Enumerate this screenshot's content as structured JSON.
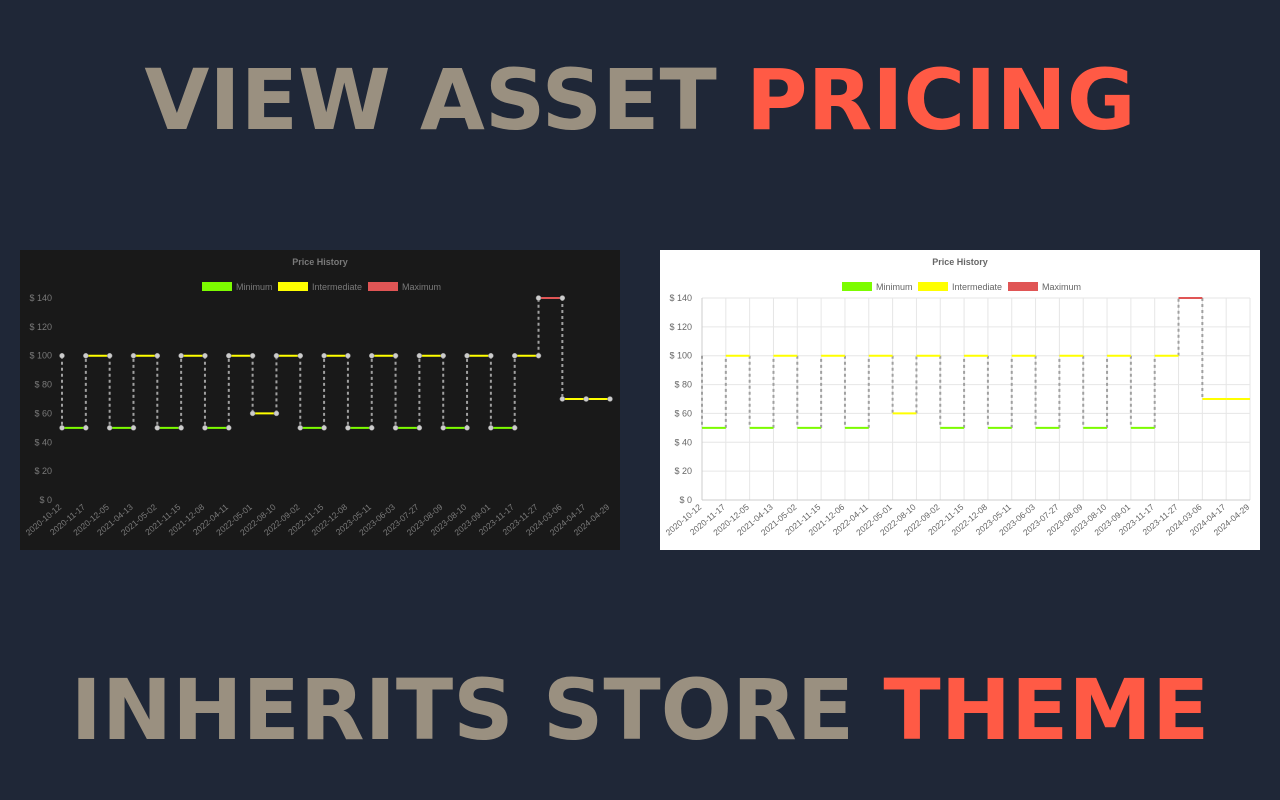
{
  "headline_top": {
    "part1": "VIEW ASSET ",
    "part2": "PRICING"
  },
  "headline_bottom": {
    "part1": "INHERITS STORE ",
    "part2": "THEME"
  },
  "colors": {
    "background": "#1f2737",
    "muted_text": "#9a9080",
    "accent_text": "#ff5a45",
    "minimum": "#7cfc00",
    "intermediate": "#ffff00",
    "maximum": "#e05555",
    "connector": "#a0a0a0"
  },
  "chart_data": [
    {
      "theme": "dark",
      "type": "line",
      "title": "Price History",
      "legend": [
        "Minimum",
        "Intermediate",
        "Maximum"
      ],
      "legend_position": "top",
      "grid": false,
      "y_tick_labels": [
        "$ 0",
        "$ 20",
        "$ 40",
        "$ 60",
        "$ 80",
        "$ 100",
        "$ 120",
        "$ 140"
      ],
      "ylim": [
        0,
        140
      ],
      "x": [
        "2020-10-12",
        "2020-11-17",
        "2020-12-05",
        "2021-04-13",
        "2021-05-02",
        "2021-11-15",
        "2021-12-08",
        "2022-04-11",
        "2022-05-01",
        "2022-08-10",
        "2022-09-02",
        "2022-11-15",
        "2022-12-08",
        "2023-05-11",
        "2023-06-03",
        "2023-07-27",
        "2023-08-09",
        "2023-08-10",
        "2023-09-01",
        "2023-11-17",
        "2023-11-27",
        "2024-03-06",
        "2024-04-17",
        "2024-04-29"
      ],
      "values": [
        50,
        100,
        50,
        100,
        50,
        100,
        50,
        100,
        60,
        100,
        50,
        100,
        50,
        100,
        50,
        100,
        50,
        100,
        50,
        100,
        140,
        70,
        70
      ],
      "levels": [
        "Minimum",
        "Intermediate",
        "Minimum",
        "Intermediate",
        "Minimum",
        "Intermediate",
        "Minimum",
        "Intermediate",
        "Intermediate",
        "Intermediate",
        "Minimum",
        "Intermediate",
        "Minimum",
        "Intermediate",
        "Minimum",
        "Intermediate",
        "Minimum",
        "Intermediate",
        "Minimum",
        "Intermediate",
        "Maximum",
        "Intermediate",
        "Intermediate"
      ]
    },
    {
      "theme": "light",
      "type": "line",
      "title": "Price History",
      "legend": [
        "Minimum",
        "Intermediate",
        "Maximum"
      ],
      "legend_position": "top",
      "grid": true,
      "y_tick_labels": [
        "$ 0",
        "$ 20",
        "$ 40",
        "$ 60",
        "$ 80",
        "$ 100",
        "$ 120",
        "$ 140"
      ],
      "ylim": [
        0,
        140
      ],
      "x": [
        "2020-10-12",
        "2020-11-17",
        "2020-12-05",
        "2021-04-13",
        "2021-05-02",
        "2021-11-15",
        "2021-12-06",
        "2022-04-11",
        "2022-05-01",
        "2022-08-10",
        "2022-09-02",
        "2022-11-15",
        "2022-12-08",
        "2023-05-11",
        "2023-06-03",
        "2023-07-27",
        "2023-08-09",
        "2023-08-10",
        "2023-09-01",
        "2023-11-17",
        "2023-11-27",
        "2024-03-06",
        "2024-04-17",
        "2024-04-29"
      ],
      "values": [
        50,
        100,
        50,
        100,
        50,
        100,
        50,
        100,
        60,
        100,
        50,
        100,
        50,
        100,
        50,
        100,
        50,
        100,
        50,
        100,
        140,
        70,
        70
      ],
      "levels": [
        "Minimum",
        "Intermediate",
        "Minimum",
        "Intermediate",
        "Minimum",
        "Intermediate",
        "Minimum",
        "Intermediate",
        "Intermediate",
        "Intermediate",
        "Minimum",
        "Intermediate",
        "Minimum",
        "Intermediate",
        "Minimum",
        "Intermediate",
        "Minimum",
        "Intermediate",
        "Minimum",
        "Intermediate",
        "Maximum",
        "Intermediate",
        "Intermediate"
      ]
    }
  ]
}
